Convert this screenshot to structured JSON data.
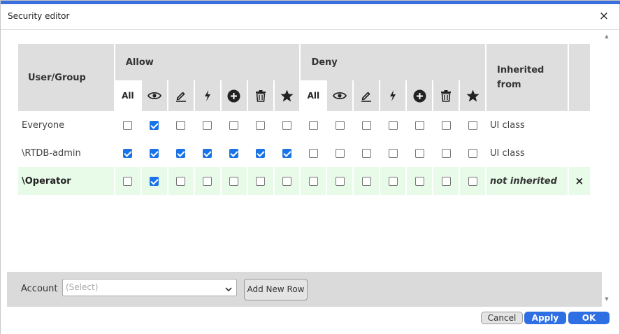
{
  "dialog": {
    "title": "Security editor",
    "close_label": "×"
  },
  "table": {
    "headers": {
      "user_group": "User/Group",
      "allow": "Allow",
      "deny": "Deny",
      "inherited_line1": "Inherited",
      "inherited_line2": "from"
    },
    "permission_icons": [
      "eye-icon",
      "pen-icon",
      "lightning-icon",
      "plus-circle-icon",
      "trash-icon",
      "star-icon"
    ],
    "all_label": "All",
    "rows": [
      {
        "name": "Everyone",
        "allow": [
          false,
          true,
          false,
          false,
          false,
          false,
          false
        ],
        "deny": [
          false,
          false,
          false,
          false,
          false,
          false,
          false
        ],
        "inherited_from": "UI class",
        "selected": false
      },
      {
        "name": "\\RTDB-admin",
        "allow": [
          true,
          true,
          true,
          true,
          true,
          true,
          true
        ],
        "deny": [
          false,
          false,
          false,
          false,
          false,
          false,
          false
        ],
        "inherited_from": "UI class",
        "selected": false
      },
      {
        "name": "\\Operator",
        "allow": [
          false,
          true,
          false,
          false,
          false,
          false,
          false
        ],
        "deny": [
          false,
          false,
          false,
          false,
          false,
          false,
          false
        ],
        "inherited_from": "not inherited",
        "selected": true,
        "remove_label": "×"
      }
    ]
  },
  "footer": {
    "account_label": "Account",
    "account_placeholder": "(Select)",
    "add_row_label": "Add New Row"
  },
  "buttons": {
    "cancel": "Cancel",
    "apply": "Apply",
    "ok": "OK"
  },
  "colors": {
    "accent": "#2f6fe4",
    "selected_row": "#e8fbe9",
    "header_bg": "#dedede"
  }
}
